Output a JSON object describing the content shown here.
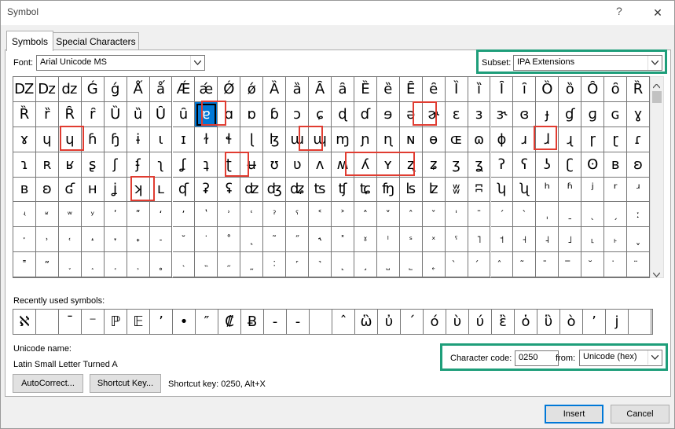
{
  "window": {
    "title": "Symbol",
    "help_glyph": "?",
    "close_glyph": "✕"
  },
  "tabs": [
    {
      "label": "Symbols"
    },
    {
      "label": "Special Characters"
    }
  ],
  "font": {
    "label": "Font:",
    "value": "Arial Unicode MS"
  },
  "subset": {
    "label": "Subset:",
    "value": "IPA Extensions"
  },
  "grid": {
    "rows": [
      [
        "Ǳ",
        "ǲ",
        "ǳ",
        "Ǵ",
        "ǵ",
        "Ǻ",
        "ǻ",
        "Ǽ",
        "ǽ",
        "Ǿ",
        "ǿ",
        "Ȁ",
        "ȁ",
        "Ȃ",
        "ȃ",
        "Ȅ",
        "ȅ",
        "Ȇ",
        "ȇ",
        "Ȉ",
        "ȉ",
        "Ȋ",
        "ȋ",
        "Ȍ",
        "ȍ",
        "Ȏ",
        "ȏ",
        "Ȑ"
      ],
      [
        "Ȑ",
        "ȑ",
        "Ȓ",
        "ȓ",
        "Ȕ",
        "ȕ",
        "Ȗ",
        "ȗ",
        "ɐ",
        "ɑ",
        "ɒ",
        "ɓ",
        "ɔ",
        "ɕ",
        "ɖ",
        "ɗ",
        "ɘ",
        "ə",
        "ɚ",
        "ɛ",
        "ɜ",
        "ɝ",
        "ɞ",
        "ɟ",
        "ɠ",
        "ɡ",
        "ɢ",
        "ɣ"
      ],
      [
        "ɤ",
        "ɥ",
        "ɥ",
        "ɦ",
        "ɧ",
        "ɨ",
        "ɩ",
        "ɪ",
        "ɫ",
        "ɬ",
        "ɭ",
        "ɮ",
        "ɯ",
        "ɰ",
        "ɱ",
        "ɲ",
        "ɳ",
        "ɴ",
        "ɵ",
        "ɶ",
        "ɷ",
        "ɸ",
        "ɹ",
        "ɺ",
        "ɻ",
        "ɼ",
        "ɽ",
        "ɾ"
      ],
      [
        "ɿ",
        "ʀ",
        "ʁ",
        "ʂ",
        "ʃ",
        "ʄ",
        "ʅ",
        "ʆ",
        "ʇ",
        "ʈ",
        "ʉ",
        "ʊ",
        "ʋ",
        "ʌ",
        "ʍ",
        "ʎ",
        "ʏ",
        "ʐ",
        "ʑ",
        "ʒ",
        "ʓ",
        "ʔ",
        "ʕ",
        "ʖ",
        "ʗ",
        "ʘ",
        "ʙ",
        "ʚ"
      ],
      [
        "ʙ",
        "ʚ",
        "ʛ",
        "ʜ",
        "ʝ",
        "ʞ",
        "ʟ",
        "ʠ",
        "ʡ",
        "ʢ",
        "ʣ",
        "ʤ",
        "ʥ",
        "ʦ",
        "ʧ",
        "ʨ",
        "ʩ",
        "ʪ",
        "ʫ",
        "ʬ",
        "ʭ",
        "ʮ",
        "ʯ",
        "ʰ",
        "ʱ",
        "ʲ",
        "ʳ",
        "ʴ"
      ],
      [
        "ʵ",
        "ʶ",
        "ʷ",
        "ʸ",
        "ʹ",
        "ʺ",
        "ʻ",
        "ʼ",
        "ʽ",
        "ʾ",
        "ʿ",
        "ˀ",
        "ˁ",
        "˂",
        "˃",
        "˄",
        "˅",
        "ˆ",
        "ˇ",
        "ˈ",
        "ˉ",
        "ˊ",
        "ˋ",
        "ˌ",
        "ˍ",
        "ˎ",
        "ˏ",
        "ː"
      ],
      [
        "ˑ",
        "˒",
        "˓",
        "˔",
        "˕",
        "˖",
        "˗",
        "˘",
        "˙",
        "˚",
        "˛",
        "˜",
        "˝",
        "˞",
        "˟",
        "ˠ",
        "ˡ",
        "ˢ",
        "ˣ",
        "ˤ",
        "˥",
        "˦",
        "˧",
        "˨",
        "˩",
        "˪",
        "˫",
        "ˬ"
      ],
      [
        "˭",
        "ˮ",
        "˯",
        "˰",
        "˱",
        "˲",
        "˳",
        "˴",
        "˵",
        "˶",
        "˷",
        "˸",
        "˹",
        "˺",
        "˻",
        "˼",
        "˽",
        "˾",
        "˿",
        "̀",
        "́",
        "̂",
        "̃",
        "̄",
        "̅",
        "̆",
        "̇",
        "̈"
      ]
    ],
    "selected": {
      "row": 1,
      "col": 8
    }
  },
  "recent": {
    "label": "Recently used symbols:",
    "symbols": [
      "ℵ",
      "",
      "¯",
      "⁻",
      "ℙ",
      "𝔼",
      "’",
      "•",
      "″",
      "₡",
      "Ƀ",
      "-",
      "-",
      "",
      "ˆ",
      "ὣ",
      "ὐ",
      "ˊ",
      "ό",
      "ὺ",
      "ύ",
      "ἒ",
      "ὁ",
      "ὓ",
      "ὸ",
      "’",
      "j",
      ""
    ]
  },
  "unicode": {
    "name_label": "Unicode name:",
    "name_value": "Latin Small Letter Turned A"
  },
  "charcode": {
    "label": "Character code:",
    "value": "0250",
    "from_label": "from:",
    "from_value": "Unicode (hex)"
  },
  "buttons": {
    "autocorrect": "AutoCorrect...",
    "shortcut_key": "Shortcut Key...",
    "shortcut_text": "Shortcut key: 0250, Alt+X",
    "insert": "Insert",
    "cancel": "Cancel"
  },
  "colors": {
    "highlight_red": "#e03c31",
    "highlight_green": "#1e9e7a",
    "selection": "#0078d7"
  }
}
